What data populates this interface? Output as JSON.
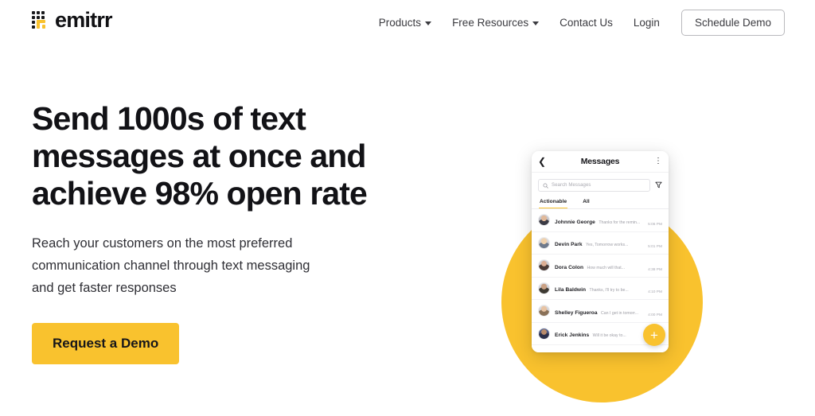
{
  "brand": {
    "name": "emitrr",
    "accent": "#F9C22E",
    "logo_icon": "emitrr-dot-grid-logo"
  },
  "header": {
    "nav": [
      {
        "label": "Products",
        "has_caret": true
      },
      {
        "label": "Free Resources",
        "has_caret": true
      },
      {
        "label": "Contact Us",
        "has_caret": false
      },
      {
        "label": "Login",
        "has_caret": false
      }
    ],
    "cta_label": "Schedule Demo"
  },
  "hero": {
    "title": "Send 1000s of text messages at once and achieve 98% open rate",
    "subtitle": "Reach your customers on the most preferred communication channel through text messaging and get faster responses",
    "cta_label": "Request a Demo"
  },
  "phone": {
    "back_icon": "chevron-left-icon",
    "title": "Messages",
    "menu_icon": "kebab-menu-icon",
    "search_icon": "search-icon",
    "search_placeholder": "Search Messages",
    "filter_icon": "funnel-filter-icon",
    "tabs": [
      {
        "label": "Actionable",
        "active": true
      },
      {
        "label": "All",
        "active": false
      }
    ],
    "messages": [
      {
        "name": "Johnnie George",
        "preview": "Thanks for the remin...",
        "time": "5:06 PM",
        "avatar": "#9b7f6c"
      },
      {
        "name": "Devin Park",
        "preview": "Yes, Tomorrow works...",
        "time": "5:01 PM",
        "avatar": "#d8b58f"
      },
      {
        "name": "Dora Colon",
        "preview": "How much will that...",
        "time": "4:38 PM",
        "avatar": "#8a6a5c"
      },
      {
        "name": "Lila Baldwin",
        "preview": "Thanks, I'll try to be...",
        "time": "4:10 PM",
        "avatar": "#7a6350"
      },
      {
        "name": "Shelley Figueroa",
        "preview": "Can I get in tomorr...",
        "time": "4:00 PM",
        "avatar": "#c2a085"
      },
      {
        "name": "Erick Jenkins",
        "preview": "Will it be okay to...",
        "time": "",
        "avatar": "#4a4f6b"
      }
    ],
    "fab_icon": "plus-icon",
    "fab_label": "+"
  }
}
